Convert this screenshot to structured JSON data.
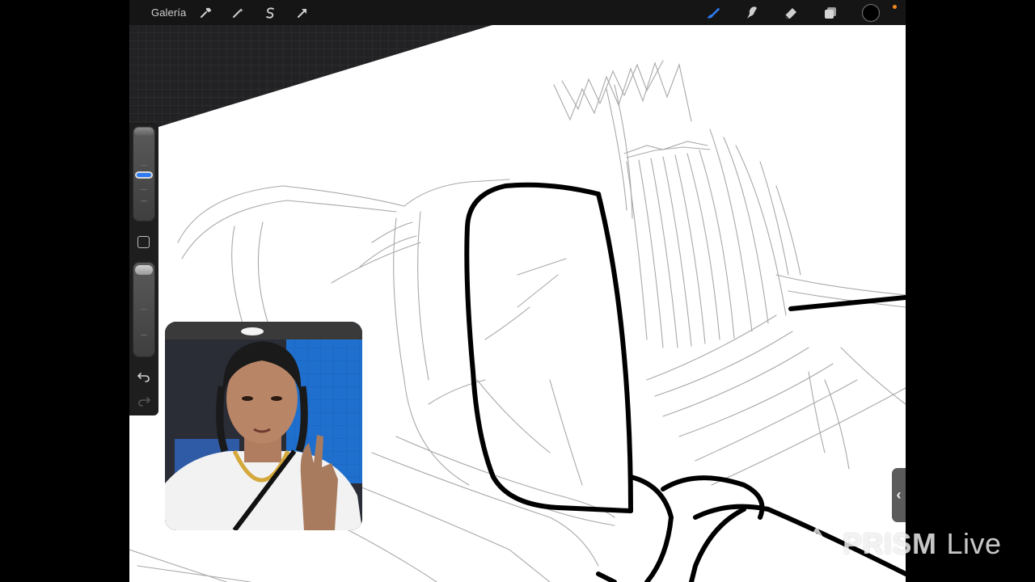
{
  "toolbar": {
    "gallery_label": "Galería",
    "left_tools": [
      "wrench-icon",
      "magic-wand-icon",
      "selection-s-icon",
      "transform-arrow-icon"
    ],
    "right_tools": [
      "brush-icon",
      "smudge-icon",
      "eraser-icon",
      "layers-icon",
      "color-swatch"
    ],
    "active_tool": "brush-icon",
    "accent_color": "#2f7bf5",
    "current_color": "#000000",
    "status_dot_color": "#f08a1c"
  },
  "sidebar": {
    "brush_size_level": 0.62,
    "opacity_level": 0.92,
    "modify_button": "square-icon",
    "undo": "undo-icon",
    "redo": "redo-icon"
  },
  "overlay": {
    "webcam": "webcam-feed",
    "collapse_glyph": "‹"
  },
  "watermark": {
    "brand": "PRISM",
    "suffix": "Live"
  },
  "colors": {
    "canvas": "#ffffff",
    "backdrop": "#222225",
    "toolbar": "#151515",
    "ink": "#000000",
    "sketch": "#8a8a8a"
  }
}
